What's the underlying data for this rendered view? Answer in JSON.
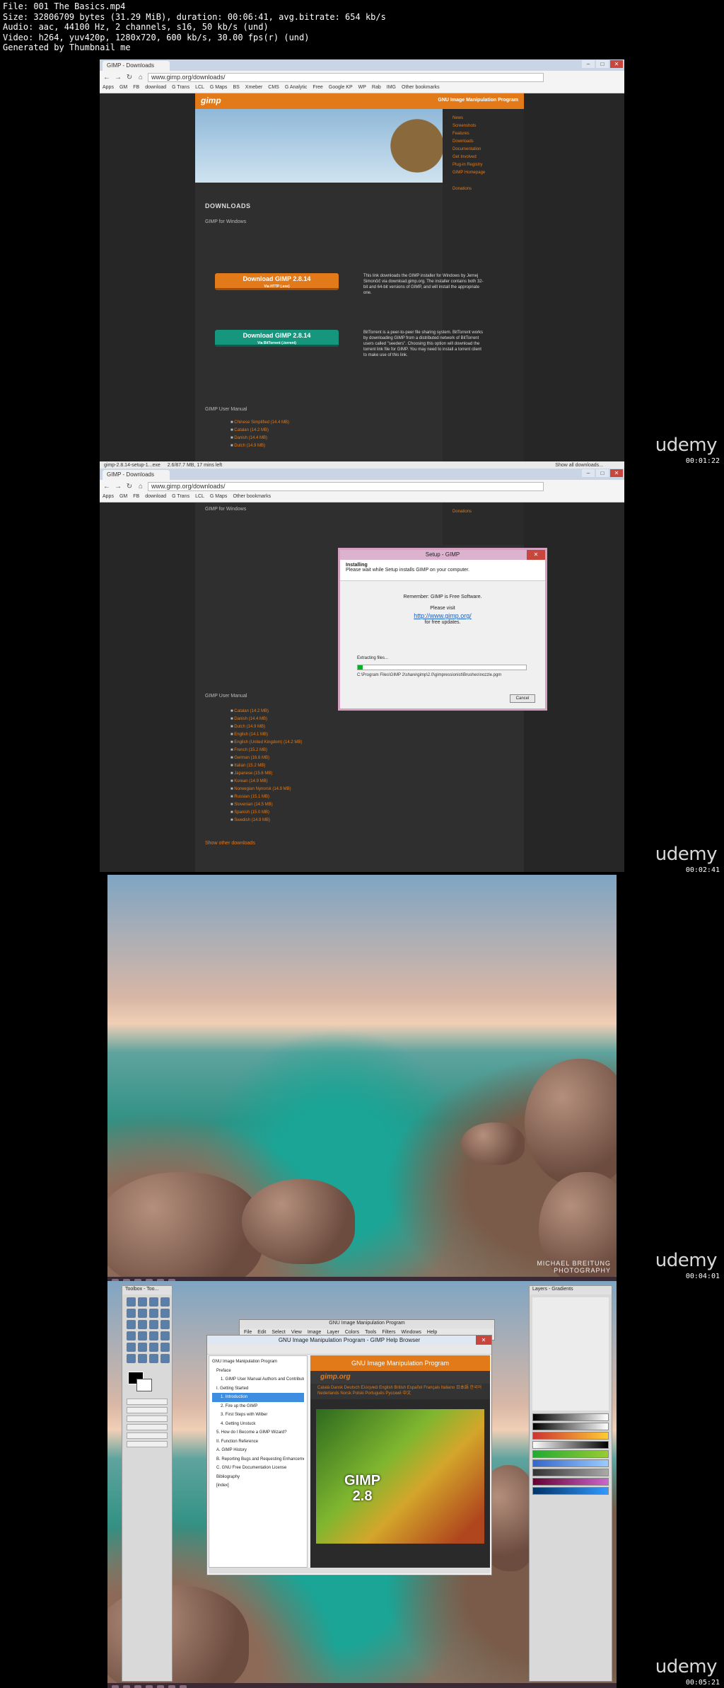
{
  "header": {
    "line1": "File: 001 The Basics.mp4",
    "line2": "Size: 32806709 bytes (31.29 MiB), duration: 00:06:41, avg.bitrate: 654 kb/s",
    "line3": "Audio: aac, 44100 Hz, 2 channels, s16, 50 kb/s (und)",
    "line4": "Video: h264, yuv420p, 1280x720, 600 kb/s, 30.00 fps(r) (und)",
    "line5": "Generated by Thumbnail me"
  },
  "brand": "udemy",
  "timestamps": [
    "00:01:22",
    "00:02:41",
    "00:04:01",
    "00:05:21"
  ],
  "browser": {
    "tab_label": "GIMP - Downloads",
    "url": "www.gimp.org/downloads/",
    "bookmarks": [
      "Apps",
      "GM",
      "FB",
      "download",
      "G Trans",
      "LCL",
      "G Maps",
      "BS",
      "Xmeber",
      "CMS",
      "G Analytic",
      "Free",
      "Google KP",
      "WP",
      "Rab",
      "IMG",
      "Other bookmarks"
    ],
    "window_buttons": [
      "–",
      "□",
      "✕"
    ]
  },
  "site": {
    "logo": "gimp",
    "tagline": "GNU Image Manipulation Program",
    "nav": [
      "News",
      "Screenshots",
      "Features",
      "Downloads",
      "Documentation",
      "Get Involved",
      "",
      "Plug-in Registry",
      "GIMP Homepage"
    ],
    "donations": "Donations",
    "section_title": "DOWNLOADS",
    "subtitle": "GIMP for Windows",
    "btn_http": "Download GIMP 2.8.14",
    "btn_http_via": "Via HTTP (.exe)",
    "btn_torrent": "Download GIMP 2.8.14",
    "btn_torrent_via": "Via BitTorrent (.torrent)",
    "para1": "This link downloads the GIMP installer for Windows by Jernej Simončič via download.gimp.org. The installer contains both 32-bit and 64-bit versions of GIMP, and will install the appropriate one.",
    "para2": "BitTorrent is a peer-to-peer file sharing system. BitTorrent works by downloading GIMP from a distributed network of BitTorrent users called \"seeders\". Choosing this option will download the torrent link file for GIMP. You may need to install a torrent client to make use of this link.",
    "manual_title": "GIMP User Manual",
    "languages_short": [
      "Chinese Simplified (14.4 MB)",
      "Catalan (14.2 MB)",
      "Danish (14.4 MB)",
      "Dutch (14.9 MB)"
    ],
    "languages_full": [
      "Catalan (14.2 MB)",
      "Danish (14.4 MB)",
      "Dutch (14.9 MB)",
      "English (14.1 MB)",
      "English (United Kingdom) (14.2 MB)",
      "French (15.2 MB)",
      "German (16.6 MB)",
      "Italian (15.2 MB)",
      "Japanese (15.6 MB)",
      "Korean (14.9 MB)",
      "Norwegian Nynorsk (14.9 MB)",
      "Russian (15.1 MB)",
      "Slovenian (14.5 MB)",
      "Spanish (15.0 MB)",
      "Swedish (14.9 MB)"
    ],
    "more_downloads": "Show other downloads"
  },
  "download_shelf": {
    "file": "gimp-2.8.14-setup-1...exe",
    "status": "2.6/87.7 MB, 17 mins left",
    "show_all": "Show all downloads..."
  },
  "setup": {
    "title": "Setup - GIMP",
    "heading": "Installing",
    "subheading": "Please wait while Setup installs GIMP on your computer.",
    "remember": "Remember: GIMP is Free Software.",
    "please_visit": "Please visit",
    "link": "http://www.gimp.org/",
    "for_updates": "for free updates.",
    "extracting": "Extracting files...",
    "path": "C:\\Program Files\\GIMP 2\\share\\gimp\\2.0\\gimpressionist\\Brushes\\nozzle.pgm",
    "progress": 0.03,
    "cancel": "Cancel"
  },
  "desktop": {
    "watermark_line1": "MICHAEL BREITUNG",
    "watermark_line2": "PHOTOGRAPHY"
  },
  "gimp": {
    "toolbox_title": "Toolbox - Too...",
    "layers_title": "Layers - Gradients",
    "main_title": "GNU Image Manipulation Program",
    "menus": [
      "File",
      "Edit",
      "Select",
      "View",
      "Image",
      "Layer",
      "Colors",
      "Tools",
      "Filters",
      "Windows",
      "Help"
    ],
    "help_title": "GNU Image Manipulation Program - GIMP Help Browser",
    "tree": [
      "GNU Image Manipulation Program",
      "Preface",
      "1. GIMP User Manual Authors and Contributors",
      "I. Getting Started",
      "1. Introduction",
      "2. Fire up the GIMP",
      "3. First Steps with Wilber",
      "4. Getting Unstuck",
      "5. How do I Become a GIMP Wizard?",
      "II. Function Reference",
      "A. GIMP History",
      "B. Reporting Bugs and Requesting Enhancements",
      "C. GNU Free Documentation License",
      "Bibliography",
      "[index]"
    ],
    "tree_selected": 4,
    "help_banner": "GNU Image Manipulation Program",
    "help_logo": "gimp.org",
    "help_langs": "Català  Dansk  Deutsch  Ελληνικά  English  British  Español  Français  Italiano  日本語  한국어  Nederlands  Norsk  Polski  Português  Русский  中文",
    "splash_text": "GIMP\n2.8"
  },
  "colors": {
    "gimp_orange": "#e37a1a",
    "teal": "#16977d"
  }
}
